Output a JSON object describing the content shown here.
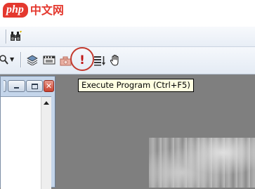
{
  "watermark": {
    "badge": "php",
    "text": "中文网"
  },
  "toolbar": {
    "icons": [
      "binoculars-icon",
      "zoom-icon",
      "layers-icon",
      "film-icon",
      "camera-icon",
      "execute-icon",
      "list-step-icon",
      "hand-icon"
    ]
  },
  "tooltip": {
    "text": "Execute Program (Ctrl+F5)"
  },
  "colors": {
    "accent": "#c33a2e",
    "tooltip_bg": "#ffffe1",
    "workspace": "#7f7f7f"
  }
}
